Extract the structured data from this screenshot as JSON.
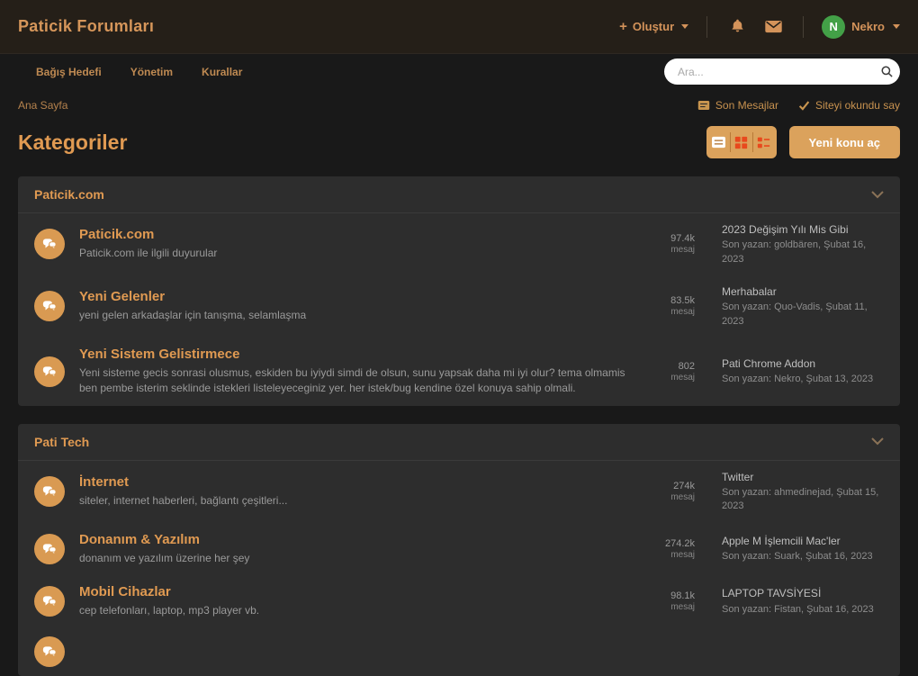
{
  "colors": {
    "accent": "#d99a52",
    "button": "#dba25c",
    "avatar_green": "#43a047",
    "toggle_icon_red": "#e8491d",
    "panel": "#2d2d2d",
    "background": "#191919"
  },
  "labels": {
    "messages_unit": "mesaj"
  },
  "header": {
    "brand": "Paticik Forumları",
    "create_label": "Oluştur",
    "user_name": "Nekro",
    "avatar_initial": "N"
  },
  "nav": {
    "items": [
      "Bağış Hedefi",
      "Yönetim",
      "Kurallar"
    ],
    "search_placeholder": "Ara..."
  },
  "breadcrumb": {
    "home": "Ana Sayfa"
  },
  "quicklinks": {
    "recent_messages": "Son Mesajlar",
    "mark_read": "Siteyi okundu say"
  },
  "page": {
    "title": "Kategoriler",
    "new_topic_label": "Yeni konu aç"
  },
  "icons": {
    "create": "plus",
    "notifications": "bell",
    "messages": "envelope",
    "search": "magnifier",
    "recent_messages": "message-square",
    "mark_read": "check",
    "view_list": "list",
    "view_grid": "grid",
    "view_detail": "list-detail",
    "forum": "chat-bubbles",
    "collapse": "chevron-down",
    "caret": "caret-down"
  },
  "sections": [
    {
      "title": "Paticik.com",
      "forums": [
        {
          "title": "Paticik.com",
          "desc": "Paticik.com ile ilgili duyurular",
          "count": "97.4k",
          "last_title": "2023 Değişim Yılı Mis Gibi",
          "last_meta": "Son yazan: goldbären, Şubat 16, 2023"
        },
        {
          "title": "Yeni Gelenler",
          "desc": "yeni gelen arkadaşlar için tanışma, selamlaşma",
          "count": "83.5k",
          "last_title": "Merhabalar",
          "last_meta": "Son yazan: Quo-Vadis, Şubat 11, 2023"
        },
        {
          "title": "Yeni Sistem Gelistirmece",
          "desc": "Yeni sisteme gecis sonrasi olusmus, eskiden bu iyiydi simdi de olsun, sunu yapsak daha mi iyi olur? tema olmamis ben pembe isterim seklinde istekleri listeleyeceginiz yer. her istek/bug kendine özel konuya sahip olmali.",
          "count": "802",
          "last_title": "Pati Chrome Addon",
          "last_meta": "Son yazan: Nekro, Şubat 13, 2023"
        }
      ]
    },
    {
      "title": "Pati Tech",
      "forums": [
        {
          "title": "İnternet",
          "desc": "siteler, internet haberleri, bağlantı çeşitleri...",
          "count": "274k",
          "last_title": "Twitter",
          "last_meta": "Son yazan: ahmedinejad, Şubat 15, 2023"
        },
        {
          "title": "Donanım & Yazılım",
          "desc": "donanım ve yazılım üzerine her şey",
          "count": "274.2k",
          "last_title": "Apple M İşlemcili Mac'ler",
          "last_meta": "Son yazan: Suark, Şubat 16, 2023"
        },
        {
          "title": "Mobil Cihazlar",
          "desc": "cep telefonları, laptop, mp3 player vb.",
          "count": "98.1k",
          "last_title": "LAPTOP TAVSİYESİ",
          "last_meta": "Son yazan: Fistan, Şubat 16, 2023"
        }
      ]
    }
  ]
}
